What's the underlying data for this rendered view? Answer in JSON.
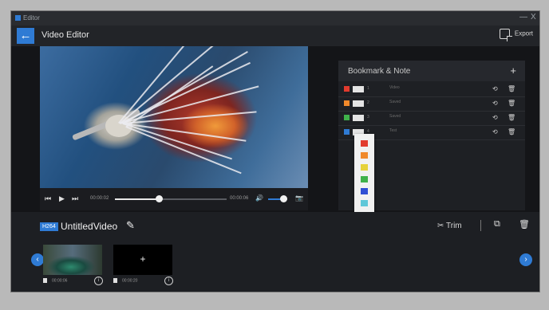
{
  "titlebar": {
    "title": "Editor",
    "minimize": "—",
    "close": "X"
  },
  "header": {
    "back": "←",
    "title": "Video Editor",
    "export_label": "Export"
  },
  "player": {
    "current_time": "00:00:02",
    "total_time": "00:00:06",
    "play": "▶",
    "prev": "⏮",
    "next": "⏭",
    "volume": "🔊",
    "snapshot": "📷",
    "progress": 0.39,
    "volume_level": 0.8
  },
  "bookmarks": {
    "title": "Bookmark & Note",
    "add": "+",
    "rows": [
      {
        "flag_color": "#e23b2e",
        "num": "1",
        "note": "Video"
      },
      {
        "flag_color": "#f0892b",
        "num": "2",
        "note": "Saved"
      },
      {
        "flag_color": "#3fb14a",
        "num": "3",
        "note": "Saved"
      },
      {
        "flag_color": "#2f7bd4",
        "num": "4",
        "note": "Test"
      }
    ],
    "colors": [
      "#e23b2e",
      "#f0892b",
      "#e6d23a",
      "#3fb14a",
      "#2f4fd4",
      "#5fc7d8",
      "#8a4fc2"
    ]
  },
  "project": {
    "badge": "H264",
    "name": "UntitledVideo",
    "trim_label": "Trim",
    "clips": [
      {
        "time": "00:00:06",
        "info": "i"
      },
      {
        "time": "00:00:20",
        "info": "i",
        "add": "+"
      }
    ]
  }
}
